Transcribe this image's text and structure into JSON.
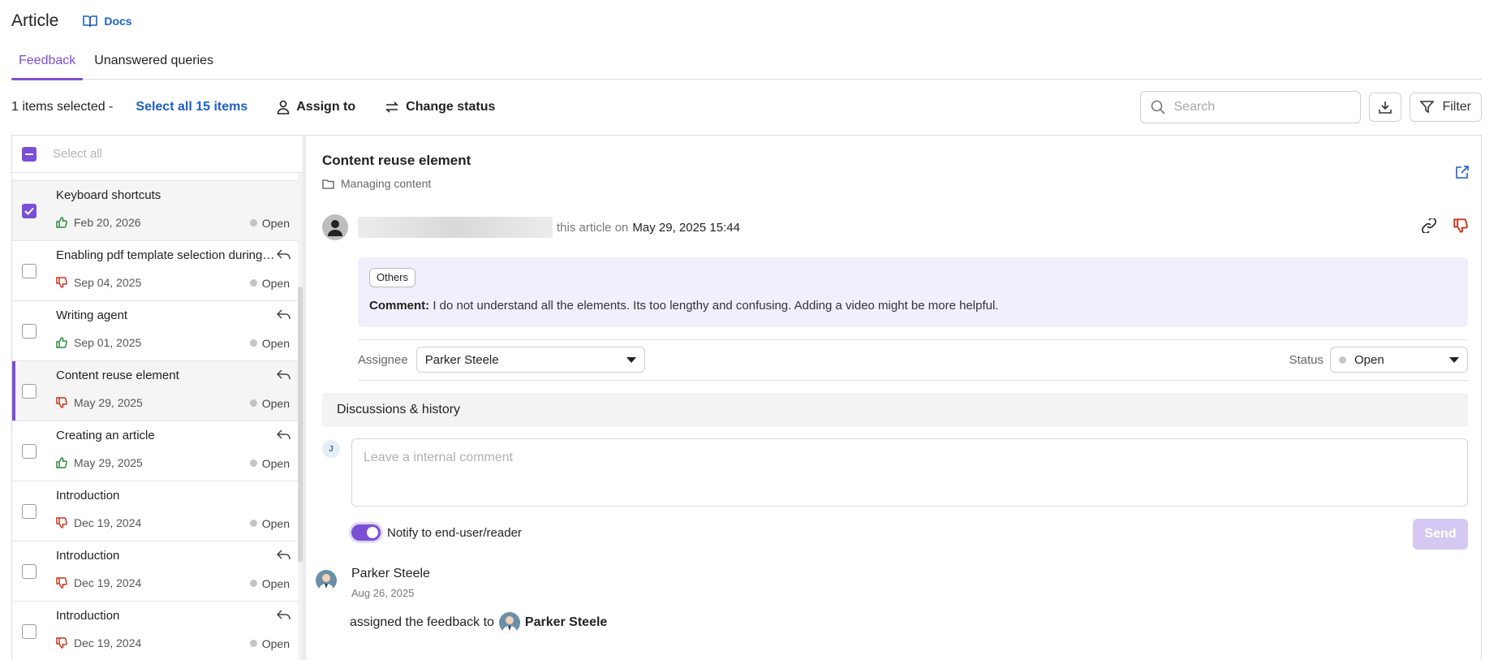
{
  "header": {
    "title": "Article",
    "docs_label": "Docs"
  },
  "tabs": [
    {
      "label": "Feedback",
      "active": true
    },
    {
      "label": "Unanswered queries",
      "active": false
    }
  ],
  "toolbar": {
    "selected_count": "1 items selected -",
    "select_all_link": "Select all 15 items",
    "assign_to": "Assign to",
    "change_status": "Change status",
    "search_placeholder": "Search",
    "filter_label": "Filter"
  },
  "list": {
    "select_all_placeholder": "Select all",
    "items": [
      {
        "title": "Keyboard shortcuts",
        "date": "Feb 20, 2026",
        "status": "Open",
        "vote": "up",
        "checked": true,
        "reply": false
      },
      {
        "title": "Enabling pdf template selection during export",
        "date": "Sep 04, 2025",
        "status": "Open",
        "vote": "down",
        "checked": false,
        "reply": true
      },
      {
        "title": "Writing agent",
        "date": "Sep 01, 2025",
        "status": "Open",
        "vote": "up",
        "checked": false,
        "reply": true
      },
      {
        "title": "Content reuse element",
        "date": "May 29, 2025",
        "status": "Open",
        "vote": "down",
        "checked": false,
        "reply": true,
        "active": true
      },
      {
        "title": "Creating an article",
        "date": "May 29, 2025",
        "status": "Open",
        "vote": "up",
        "checked": false,
        "reply": true
      },
      {
        "title": "Introduction",
        "date": "Dec 19, 2024",
        "status": "Open",
        "vote": "down",
        "checked": false,
        "reply": false
      },
      {
        "title": "Introduction",
        "date": "Dec 19, 2024",
        "status": "Open",
        "vote": "down",
        "checked": false,
        "reply": true
      },
      {
        "title": "Introduction",
        "date": "Dec 19, 2024",
        "status": "Open",
        "vote": "down",
        "checked": false,
        "reply": true
      }
    ]
  },
  "detail": {
    "title": "Content reuse element",
    "category": "Managing content",
    "activity_text": "this article on",
    "activity_date": "May 29, 2025 15:44",
    "tag": "Others",
    "comment_label": "Comment:",
    "comment_text": "I do not understand all the elements. Its too lengthy and confusing. Adding a video might be more helpful.",
    "assignee_label": "Assignee",
    "assignee_value": "Parker Steele",
    "status_label": "Status",
    "status_value": "Open",
    "discussions_title": "Discussions & history",
    "commenter_initial": "J",
    "comment_placeholder": "Leave a internal comment",
    "notify_label": "Notify to end-user/reader",
    "send_label": "Send",
    "history": {
      "name": "Parker Steele",
      "date": "Aug 26, 2025",
      "action_text": "assigned the feedback to",
      "target": "Parker Steele"
    }
  },
  "colors": {
    "accent": "#7b4fd6",
    "link": "#1d5fc9",
    "thumb_up": "#2e8b3e",
    "thumb_down": "#c8341c"
  }
}
